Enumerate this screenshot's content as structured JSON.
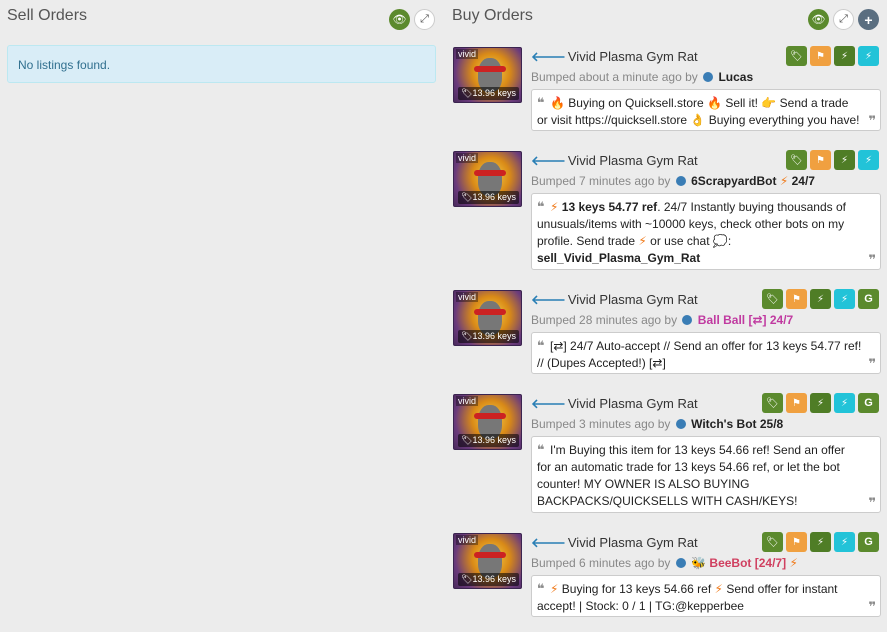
{
  "sell": {
    "title": "Sell Orders",
    "empty_message": "No listings found."
  },
  "buy": {
    "title": "Buy Orders",
    "add_symbol": "+"
  },
  "listings": [
    {
      "quality": "vivid",
      "price": "13.96 keys",
      "name": "Vivid Plasma Gym Rat",
      "bumped": "Bumped about a minute ago by",
      "user": "Lucas",
      "comment": {
        "t1": "Buying on Quicksell.store",
        "t2": "Sell it!",
        "t3": "Send a trade or visit https://quicksell.store",
        "t4": "Buying everything you have!"
      }
    },
    {
      "quality": "vivid",
      "price": "13.96 keys",
      "name": "Vivid Plasma Gym Rat",
      "bumped": "Bumped 7 minutes ago by",
      "user": "6ScrapyardBot",
      "user_suffix": "24/7",
      "comment": {
        "bold": "13 keys 54.77 ref",
        "t1": ". 24/7 Instantly buying thousands of unusuals/items with ~10000 keys, check other bots on my profile. Send  trade",
        "t2": " or  use  chat",
        "t3": ":",
        "cmd": "sell_Vivid_Plasma_Gym_Rat"
      }
    },
    {
      "quality": "vivid",
      "price": "13.96 keys",
      "name": "Vivid Plasma Gym Rat",
      "bumped": "Bumped 28 minutes ago by",
      "user": "Ball Ball [⇄] 24/7",
      "comment": {
        "t1": "[⇄] 24/7 Auto-accept // Send an offer for 13 keys 54.77 ref! // (Dupes Accepted!) [⇄]"
      }
    },
    {
      "quality": "vivid",
      "price": "13.96 keys",
      "name": "Vivid Plasma Gym Rat",
      "bumped": "Bumped 3 minutes ago by",
      "user": "Witch's Bot 25/8",
      "comment": {
        "t1": "I'm Buying this item for 13 keys 54.66 ref! Send an offer for an automatic trade for 13 keys 54.66 ref, or let the bot counter! MY OWNER IS ALSO BUYING BACKPACKS/QUICKSELLS WITH CASH/KEYS!"
      }
    },
    {
      "quality": "vivid",
      "price": "13.96 keys",
      "name": "Vivid Plasma Gym Rat",
      "bumped": "Bumped 6 minutes ago by",
      "user": "BeeBot [24/7]",
      "comment": {
        "t1": "Buying for 13 keys 54.66 ref",
        "t2": "Send offer for instant accept! | Stock: 0 / 1 | TG:@kepperbee"
      }
    }
  ],
  "quote_open": "❝",
  "quote_close": "❞",
  "g_label": "G"
}
